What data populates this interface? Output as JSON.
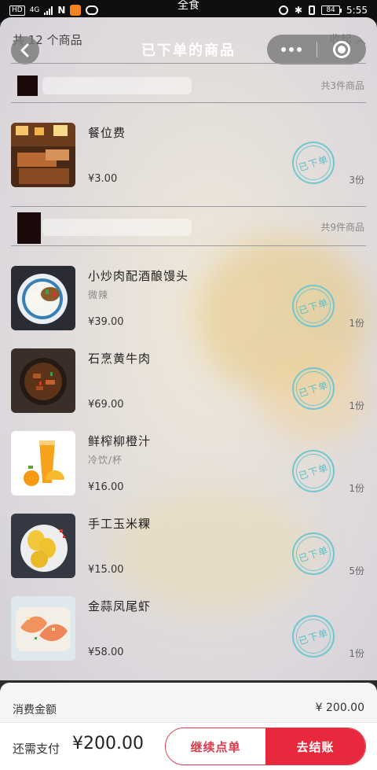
{
  "status_bar": {
    "carrier_badge": "HD",
    "network": "4G",
    "center_text": "全食",
    "battery": "84",
    "time": "5:55"
  },
  "nav": {
    "title": "已下单的商品"
  },
  "list": {
    "summary": "共 12 个商品",
    "collapse_label": "收起"
  },
  "groups": [
    {
      "count": "共3件商品",
      "items": [
        {
          "name": "餐位费",
          "spec": "",
          "price": "¥3.00",
          "qty": "3份",
          "stamp": "已下单"
        }
      ]
    },
    {
      "count": "共9件商品",
      "items": [
        {
          "name": "小炒肉配酒酿馒头",
          "spec": "微辣",
          "price": "¥39.00",
          "qty": "1份",
          "stamp": "已下单"
        },
        {
          "name": "石烹黄牛肉",
          "spec": "",
          "price": "¥69.00",
          "qty": "1份",
          "stamp": "已下单"
        },
        {
          "name": "鲜榨柳橙汁",
          "spec": "冷饮/杯",
          "price": "¥16.00",
          "qty": "1份",
          "stamp": "已下单"
        },
        {
          "name": "手工玉米粿",
          "spec": "",
          "price": "¥15.00",
          "qty": "5份",
          "stamp": "已下单"
        },
        {
          "name": "金蒜凤尾虾",
          "spec": "",
          "price": "¥58.00",
          "qty": "1份",
          "stamp": "已下单"
        }
      ]
    }
  ],
  "summary": {
    "label": "消费金额",
    "value": "¥ 200.00"
  },
  "bottom": {
    "pay_label": "还需支付",
    "pay_value": "¥200.00",
    "continue_label": "继续点单",
    "checkout_label": "去结账"
  }
}
